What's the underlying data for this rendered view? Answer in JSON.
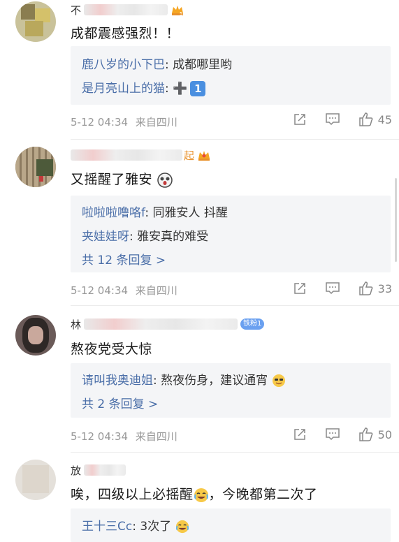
{
  "comments": [
    {
      "name": "不",
      "text": "成都震感强烈！！",
      "replies": [
        {
          "user": "鹿八岁的小下巴",
          "sep": ":",
          "body": " 成都哪里哟"
        },
        {
          "user": "是月亮山上的猫",
          "sep": ":",
          "body": " ➕",
          "badge": "1"
        }
      ],
      "more": "",
      "time": "5-12 04:34",
      "location": "来自四川",
      "likes": "45"
    },
    {
      "name": "",
      "name_tail": "起",
      "text": "又摇醒了雅安",
      "replies": [
        {
          "user": "啦啦啦噜咯f",
          "sep": ":",
          "body": " 同雅安人 抖醒"
        },
        {
          "user": "夹娃娃呀",
          "sep": ":",
          "body": " 雅安真的难受"
        }
      ],
      "more": "共 12 条回复 >",
      "time": "5-12 04:34",
      "location": "来自四川",
      "likes": "33"
    },
    {
      "name": "林",
      "fan_badge": "铁粉1",
      "text": "熬夜党受大惊",
      "replies": [
        {
          "user": "请叫我奥迪姐",
          "sep": ":",
          "body": " 熬夜伤身，建议通宵"
        }
      ],
      "more": "共 2 条回复 >",
      "time": "5-12 04:34",
      "location": "来自四川",
      "likes": "50"
    },
    {
      "name": "放",
      "text": "唉，四级以上必摇醒",
      "text_tail": "，今晚都第二次了",
      "replies": [
        {
          "user": "王十三Cc",
          "sep": ":",
          "body": " 3次了"
        }
      ]
    }
  ],
  "icons": {
    "share": "share-icon",
    "comment": "comment-icon",
    "like": "like-icon"
  },
  "colors": {
    "link": "#4a6ea8",
    "meta": "#999999",
    "reply_bg": "#f4f5f7"
  }
}
